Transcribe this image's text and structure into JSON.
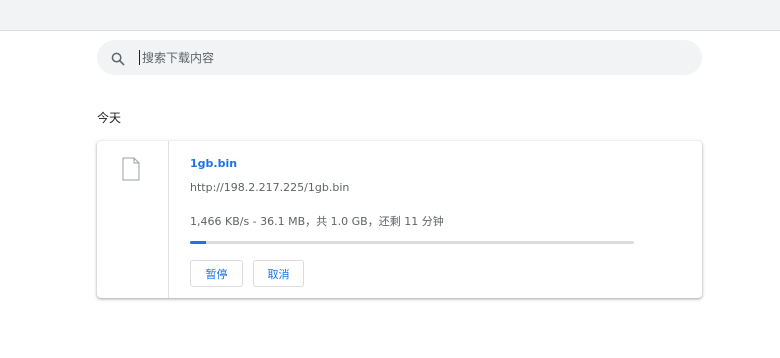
{
  "search": {
    "placeholder": "搜索下载内容",
    "value": ""
  },
  "section": {
    "title": "今天"
  },
  "download": {
    "file_name": "1gb.bin",
    "url": "http://198.2.217.225/1gb.bin",
    "status": "1,466 KB/s - 36.1 MB，共 1.0 GB，还剩 11 分钟",
    "progress_fraction": 0.035,
    "pause_label": "暂停",
    "cancel_label": "取消",
    "file_icon": "file-icon"
  },
  "icons": {
    "search": "search-icon"
  },
  "colors": {
    "accent": "#1a73e8",
    "toolbar_bg": "#f1f3f4",
    "secondary_text": "#5f6368",
    "progress_track": "#dadce0"
  }
}
